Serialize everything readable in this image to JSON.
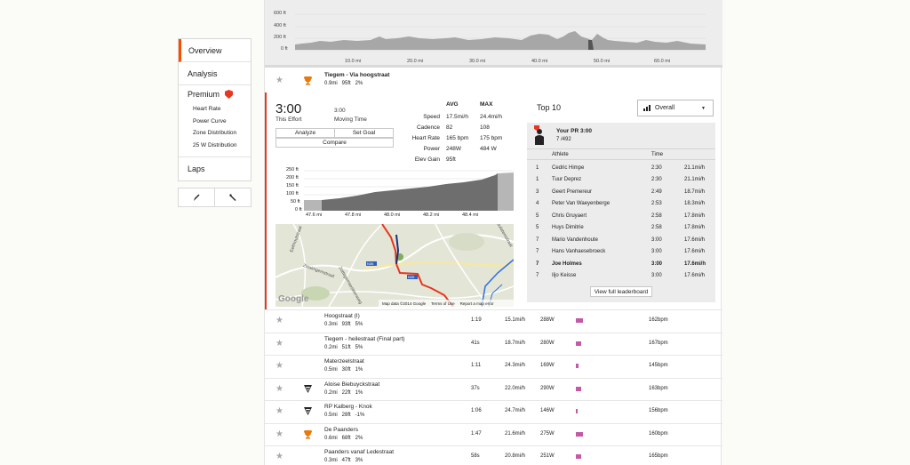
{
  "sidebar": {
    "items": [
      {
        "label": "Overview"
      },
      {
        "label": "Analysis"
      }
    ],
    "premium": {
      "label": "Premium",
      "subitems": [
        "Heart Rate",
        "Power Curve",
        "Zone Distribution",
        "25 W Distribution"
      ]
    },
    "laps": "Laps",
    "tools": [
      "pencil-icon",
      "wrench-icon"
    ]
  },
  "elevation_profile": {
    "y_labels": [
      "600 ft",
      "400 ft",
      "200 ft",
      "0 ft"
    ],
    "x_labels": [
      "10.0 mi",
      "20.0 mi",
      "30.0 mi",
      "40.0 mi",
      "50.0 mi",
      "60.0 mi"
    ]
  },
  "segment": {
    "name": "Tiegem - Via hoogstraat",
    "stats": "0.9mi   95ft   2%",
    "effort_time": "3:00",
    "effort_label": "This Effort",
    "moving_time": "3:00",
    "moving_label": "Moving Time",
    "buttons": {
      "analyze": "Analyze",
      "set_goal": "Set Goal",
      "compare": "Compare"
    },
    "table": {
      "headers": [
        "AVG",
        "MAX"
      ],
      "rows": [
        {
          "label": "Speed",
          "avg": "17.5mi/h",
          "max": "24.4mi/h"
        },
        {
          "label": "Cadence",
          "avg": "82",
          "max": "108"
        },
        {
          "label": "Heart Rate",
          "avg": "165 bpm",
          "max": "175 bpm"
        },
        {
          "label": "Power",
          "avg": "248W",
          "max": "484 W"
        },
        {
          "label": "Elev Gain",
          "avg": "95ft",
          "max": ""
        }
      ]
    },
    "mini_elev": {
      "y_labels": [
        "250 ft",
        "200 ft",
        "150 ft",
        "100 ft",
        "50 ft",
        "0 ft"
      ],
      "x_labels": [
        "47.6 mi",
        "47.8 mi",
        "48.0 mi",
        "48.2 mi",
        "48.4 mi"
      ]
    },
    "map": {
      "attribution": [
        "Map data ©2014 Google",
        "Terms of Use",
        "Report a map error"
      ],
      "labels": [
        "Zwalmgemstraat",
        "Zottegemsesteenweg",
        "Paulatemstraat",
        "N36",
        "N35",
        "Eekhoutstraat"
      ],
      "google": "Google"
    }
  },
  "leaderboard": {
    "title": "Top 10",
    "filter": "Overall",
    "pr_title": "Your PR 3:00",
    "pr_rank": "7 /492",
    "columns": [
      "Athlete",
      "Time"
    ],
    "rows": [
      {
        "rank": "1",
        "athlete": "Cedric Himpe",
        "time": "2:30",
        "speed": "21.1mi/h"
      },
      {
        "rank": "1",
        "athlete": "Tuur Deprez",
        "time": "2:30",
        "speed": "21.1mi/h"
      },
      {
        "rank": "3",
        "athlete": "Geert Premereur",
        "time": "2:49",
        "speed": "18.7mi/h"
      },
      {
        "rank": "4",
        "athlete": "Peter Van Waeyenberge",
        "time": "2:53",
        "speed": "18.3mi/h"
      },
      {
        "rank": "5",
        "athlete": "Chris Gruyaert",
        "time": "2:58",
        "speed": "17.8mi/h"
      },
      {
        "rank": "5",
        "athlete": "Huys Dimitrie",
        "time": "2:58",
        "speed": "17.8mi/h"
      },
      {
        "rank": "7",
        "athlete": "Mario Vandenhoute",
        "time": "3:00",
        "speed": "17.6mi/h"
      },
      {
        "rank": "7",
        "athlete": "Hans Vanhaesebroeck",
        "time": "3:00",
        "speed": "17.6mi/h"
      },
      {
        "rank": "7",
        "athlete": "Joe Holmes",
        "time": "3:00",
        "speed": "17.6mi/h",
        "me": true
      },
      {
        "rank": "7",
        "athlete": "Iljo Keisse",
        "time": "3:00",
        "speed": "17.6mi/h"
      }
    ],
    "full_button": "View full leaderboard"
  },
  "segments": [
    {
      "name": "Hoogstraat (I)",
      "stats": "0.3mi   93ft   5%",
      "icon": "",
      "time": "1:19",
      "speed": "15.1mi/h",
      "power": "288W",
      "power_level": 0.11,
      "hr": "162bpm"
    },
    {
      "name": "Tiegem - heilestraat (Final part)",
      "stats": "0.2mi   51ft   5%",
      "icon": "",
      "time": "41s",
      "speed": "18.7mi/h",
      "power": "280W",
      "power_level": 0.08,
      "hr": "167bpm"
    },
    {
      "name": "Materzeelstraat",
      "stats": "0.5mi   30ft   1%",
      "icon": "",
      "time": "1:11",
      "speed": "24.3mi/h",
      "power": "169W",
      "power_level": 0.04,
      "hr": "145bpm"
    },
    {
      "name": "Aloise Biebuyckstraat",
      "stats": "0.2mi   22ft   1%",
      "icon": "kom-icon",
      "time": "37s",
      "speed": "22.0mi/h",
      "power": "290W",
      "power_level": 0.08,
      "hr": "163bpm"
    },
    {
      "name": "RP Kalberg - Knok",
      "stats": "0.5mi   28ft   -1%",
      "icon": "kom-icon",
      "time": "1:06",
      "speed": "24.7mi/h",
      "power": "146W",
      "power_level": 0.03,
      "hr": "156bpm"
    },
    {
      "name": "De Paanders",
      "stats": "0.6mi   68ft   2%",
      "icon": "trophy-icon",
      "time": "1:47",
      "speed": "21.6mi/h",
      "power": "275W",
      "power_level": 0.11,
      "hr": "160bpm"
    },
    {
      "name": "Paanders vanaf Ledestraat",
      "stats": "0.3mi   47ft   3%",
      "icon": "",
      "time": "58s",
      "speed": "20.8mi/h",
      "power": "251W",
      "power_level": 0.08,
      "hr": "165bpm"
    }
  ]
}
